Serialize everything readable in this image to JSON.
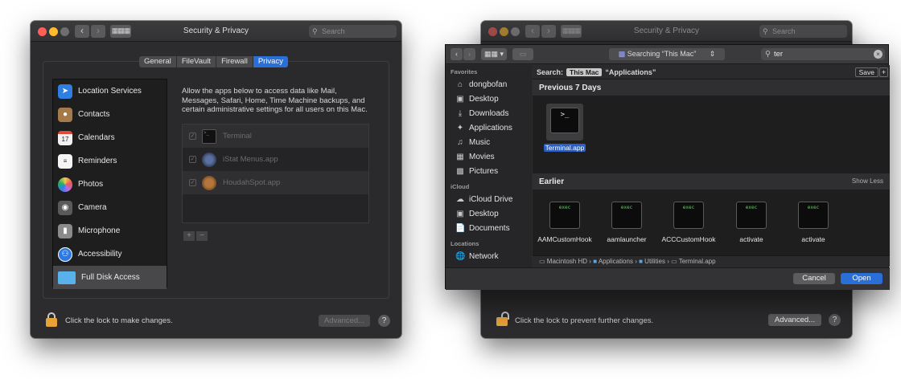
{
  "security_window": {
    "title": "Security & Privacy",
    "search_placeholder": "Search",
    "tabs": [
      {
        "label": "General",
        "active": false
      },
      {
        "label": "FileVault",
        "active": false
      },
      {
        "label": "Firewall",
        "active": false
      },
      {
        "label": "Privacy",
        "active": true
      }
    ],
    "categories": [
      {
        "label": "Location Services",
        "icon": "location-arrow-icon",
        "color": "#2f7fe3"
      },
      {
        "label": "Contacts",
        "icon": "contacts-book-icon",
        "color": "#a57a4a"
      },
      {
        "label": "Calendars",
        "icon": "calendar-icon",
        "color": "#f2f2f2"
      },
      {
        "label": "Reminders",
        "icon": "reminders-list-icon",
        "color": "#f5f5f5"
      },
      {
        "label": "Photos",
        "icon": "photos-flower-icon",
        "color": "#e8a33c"
      },
      {
        "label": "Camera",
        "icon": "camera-icon",
        "color": "#5a5a5a"
      },
      {
        "label": "Microphone",
        "icon": "microphone-icon",
        "color": "#8a8a8a"
      },
      {
        "label": "Accessibility",
        "icon": "accessibility-icon",
        "color": "#2d7ae5"
      },
      {
        "label": "Full Disk Access",
        "icon": "folder-icon",
        "color": "#58b1ea",
        "selected": true
      }
    ],
    "description": "Allow the apps below to access data like Mail, Messages, Safari, Home, Time Machine backups, and certain administrative settings for all users on this Mac.",
    "apps": [
      {
        "label": "Terminal",
        "icon": "terminal-icon",
        "checked": true
      },
      {
        "label": "iStat Menus.app",
        "icon": "istat-menus-icon",
        "checked": true
      },
      {
        "label": "HoudahSpot.app",
        "icon": "houdahspot-icon",
        "checked": true
      }
    ],
    "add_label": "+",
    "remove_label": "−",
    "lock_text": "Click the lock to make changes.",
    "advanced_label": "Advanced...",
    "help_label": "?"
  },
  "back_window": {
    "title": "Security & Privacy",
    "search_placeholder": "Search",
    "lock_text": "Click the lock to prevent further changes.",
    "advanced_label": "Advanced...",
    "help_label": "?"
  },
  "finder_dialog": {
    "location_label": "Searching “This Mac”",
    "search_value": "ter",
    "sidebar": {
      "favorites_header": "Favorites",
      "favorites": [
        {
          "label": "dongbofan",
          "icon": "home-icon"
        },
        {
          "label": "Desktop",
          "icon": "desktop-icon"
        },
        {
          "label": "Downloads",
          "icon": "downloads-icon"
        },
        {
          "label": "Applications",
          "icon": "applications-icon"
        },
        {
          "label": "Music",
          "icon": "music-note-icon"
        },
        {
          "label": "Movies",
          "icon": "movies-icon"
        },
        {
          "label": "Pictures",
          "icon": "pictures-icon"
        }
      ],
      "icloud_header": "iCloud",
      "icloud": [
        {
          "label": "iCloud Drive",
          "icon": "cloud-icon"
        },
        {
          "label": "Desktop",
          "icon": "desktop-icon"
        },
        {
          "label": "Documents",
          "icon": "documents-icon"
        }
      ],
      "locations_header": "Locations",
      "locations": [
        {
          "label": "Network",
          "icon": "network-globe-icon"
        }
      ]
    },
    "scope": {
      "search_label": "Search:",
      "this_mac": "This Mac",
      "applications": "“Applications”",
      "save_label": "Save",
      "plus_label": "+"
    },
    "groups": {
      "recent_title": "Previous 7 Days",
      "earlier_title": "Earlier",
      "show_less": "Show Less"
    },
    "recent_items": [
      {
        "label": "Terminal.app",
        "icon_text": ">_"
      }
    ],
    "earlier_items": [
      {
        "label": "AAMCustomHook",
        "icon_text": "exec"
      },
      {
        "label": "aamlauncher",
        "icon_text": "exec"
      },
      {
        "label": "ACCCustomHook",
        "icon_text": "exec"
      },
      {
        "label": "activate",
        "icon_text": "exec"
      },
      {
        "label": "activate",
        "icon_text": "exec"
      }
    ],
    "path": [
      "Macintosh HD",
      "Applications",
      "Utilities",
      "Terminal.app"
    ],
    "path_sep": "›",
    "cancel_label": "Cancel",
    "open_label": "Open"
  }
}
